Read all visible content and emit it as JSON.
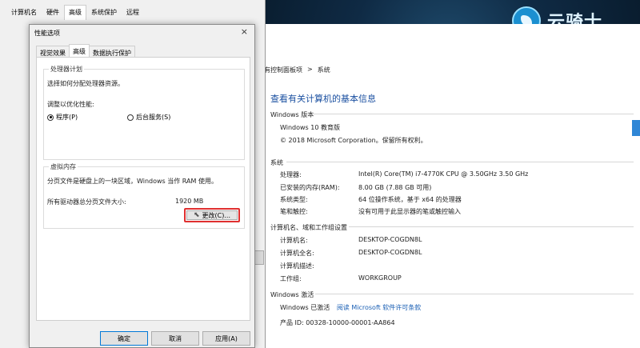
{
  "desktop": {
    "logo_text": "云骑士"
  },
  "sysprop": {
    "tabs": [
      "计算机名",
      "硬件",
      "高级",
      "系统保护",
      "远程"
    ]
  },
  "perf": {
    "title": "性能选项",
    "close_glyph": "×",
    "tabs": [
      "视觉效果",
      "高级",
      "数据执行保护"
    ],
    "scheduling": {
      "legend": "处理器计划",
      "description": "选择如何分配处理器资源。",
      "adjust_label": "调整以优化性能:",
      "option_programs": "程序(P)",
      "option_services": "后台服务(S)"
    },
    "virtual_memory": {
      "legend": "虚拟内存",
      "description": "分页文件是硬盘上的一块区域，Windows 当作 RAM 使用。",
      "total_label": "所有驱动器总分页文件大小:",
      "total_value": "1920 MB",
      "change_button": "更改(C)..."
    },
    "buttons": {
      "ok": "确定",
      "cancel": "取消",
      "apply": "应用(A)"
    }
  },
  "system": {
    "breadcrumb": [
      "有控制面板项",
      ">",
      "系统"
    ],
    "title": "查看有关计算机的基本信息",
    "edition": {
      "header": "Windows 版本",
      "name": "Windows 10 教育版",
      "copyright": "© 2018 Microsoft Corporation。保留所有权利。"
    },
    "system": {
      "header": "系统",
      "rows": [
        {
          "k": "处理器:",
          "v": "Intel(R) Core(TM) i7-4770K CPU @ 3.50GHz   3.50 GHz"
        },
        {
          "k": "已安装的内存(RAM):",
          "v": "8.00 GB (7.88 GB 可用)"
        },
        {
          "k": "系统类型:",
          "v": "64 位操作系统，基于 x64 的处理器"
        },
        {
          "k": "笔和触控:",
          "v": "没有可用于此显示器的笔或触控输入"
        }
      ]
    },
    "computer": {
      "header": "计算机名、域和工作组设置",
      "rows": [
        {
          "k": "计算机名:",
          "v": "DESKTOP-COGDN8L"
        },
        {
          "k": "计算机全名:",
          "v": "DESKTOP-COGDN8L"
        },
        {
          "k": "计算机描述:",
          "v": ""
        },
        {
          "k": "工作组:",
          "v": "WORKGROUP"
        }
      ]
    },
    "activation": {
      "header": "Windows 激活",
      "status": "Windows 已激活",
      "link": "阅读 Microsoft 软件许可条款",
      "product_id": "产品 ID: 00328-10000-00001-AA864"
    }
  }
}
